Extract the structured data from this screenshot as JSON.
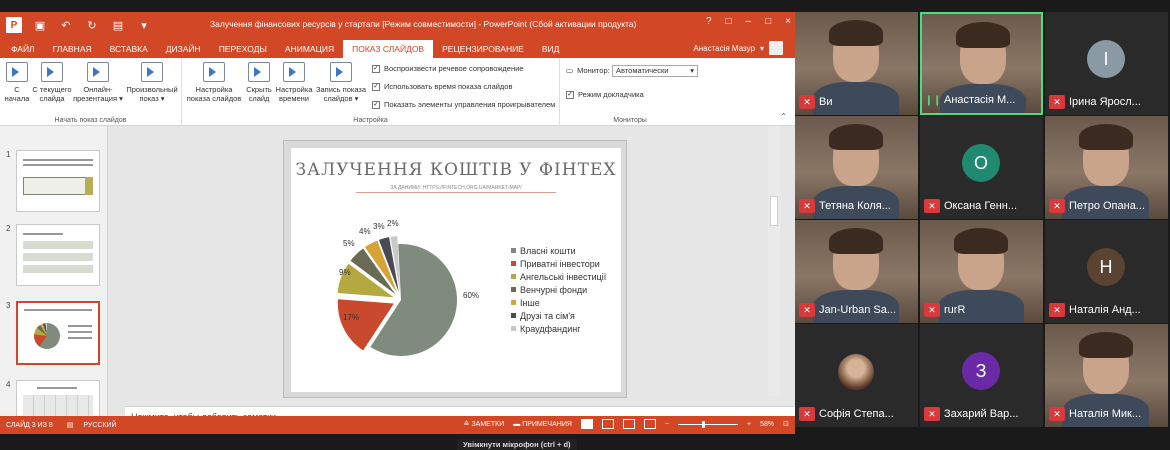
{
  "window": {
    "title": "Залучення фінансових ресурсів у стартапи [Режим совместимости] - PowerPoint (Сбой активации продукта)",
    "app_icon": "P",
    "winctl": [
      "?",
      "□",
      "–",
      "□",
      "×"
    ]
  },
  "tabs": [
    {
      "label": "ФАЙЛ",
      "active": false
    },
    {
      "label": "ГЛАВНАЯ",
      "active": false
    },
    {
      "label": "ВСТАВКА",
      "active": false
    },
    {
      "label": "ДИЗАЙН",
      "active": false
    },
    {
      "label": "ПЕРЕХОДЫ",
      "active": false
    },
    {
      "label": "АНИМАЦИЯ",
      "active": false
    },
    {
      "label": "ПОКАЗ СЛАЙДОВ",
      "active": true
    },
    {
      "label": "РЕЦЕНЗИРОВАНИЕ",
      "active": false
    },
    {
      "label": "ВИД",
      "active": false
    }
  ],
  "user": {
    "name": "Анастасія Мазур"
  },
  "ribbon": {
    "group1": {
      "label": "Начать показ слайдов",
      "buttons": [
        {
          "l1": "С",
          "l2": "начала"
        },
        {
          "l1": "С текущего",
          "l2": "слайда"
        },
        {
          "l1": "Онлайн-",
          "l2": "презентация ▾"
        },
        {
          "l1": "Произвольный",
          "l2": "показ ▾"
        }
      ]
    },
    "group2": {
      "label": "Настройка",
      "buttons": [
        {
          "l1": "Настройка",
          "l2": "показа слайдов"
        },
        {
          "l1": "Скрыть",
          "l2": "слайд"
        },
        {
          "l1": "Настройка",
          "l2": "времени"
        },
        {
          "l1": "Запись показа",
          "l2": "слайдов ▾"
        }
      ],
      "checks": [
        {
          "label": "Воспроизвести речевое сопровождение",
          "checked": true
        },
        {
          "label": "Использовать время показа слайдов",
          "checked": true
        },
        {
          "label": "Показать элементы управления проигрывателем",
          "checked": true
        }
      ]
    },
    "group3": {
      "label": "Мониторы",
      "monitor_label": "Монитор:",
      "monitor_value": "Автоматически",
      "presenter_label": "Режим докладчика"
    }
  },
  "thumbnails": [
    {
      "num": "1",
      "selected": false
    },
    {
      "num": "2",
      "selected": false
    },
    {
      "num": "3",
      "selected": true
    },
    {
      "num": "4",
      "selected": false
    }
  ],
  "slide": {
    "title": "ЗАЛУЧЕННЯ КОШТІВ У ФІНТЕХ",
    "subtitle": "ЗА ДАНИМИ: HTTPS://FINTECH.ORG.UA/MARKET-MAP/",
    "chart_data": {
      "type": "pie",
      "categories": [
        "Власні кошти",
        "Приватні інвестори",
        "Ангельські інвестиції",
        "Венчурні фонди",
        "Інше",
        "Друзі та сім'я",
        "Краудфандинг"
      ],
      "values": [
        60,
        17,
        9,
        5,
        4,
        3,
        2
      ],
      "labels": [
        "60%",
        "17%",
        "9%",
        "5%",
        "4%",
        "3%",
        "2%"
      ],
      "colors": [
        "#7f8b7d",
        "#c8492d",
        "#b3a93e",
        "#6b6a55",
        "#d6a436",
        "#4a4a55",
        "#c9c9c9"
      ],
      "legend_position": "right"
    }
  },
  "notes": {
    "placeholder": "Нажмите, чтобы добавить заметки"
  },
  "status": {
    "slide": "СЛАЙД 3 ИЗ 8",
    "lang": "РУССКИЙ",
    "notes": "ЗАМЕТКИ",
    "comments": "ПРИМЕЧАНИЯ",
    "zoom": "58%"
  },
  "tooltip": "Увімкнути мікрофон (ctrl + d)",
  "participants": [
    {
      "name": "Ви",
      "kind": "video",
      "muted": true
    },
    {
      "name": "Анастасія М...",
      "kind": "video",
      "muted": false,
      "speaking": true
    },
    {
      "name": "Ірина Яросл...",
      "kind": "initial",
      "initial": "І",
      "color": "#8a9aa4",
      "muted": true
    },
    {
      "name": "Тетяна Коля...",
      "kind": "video",
      "muted": true
    },
    {
      "name": "Оксана Генн...",
      "kind": "initial",
      "initial": "О",
      "color": "#1f8a6f",
      "muted": true
    },
    {
      "name": "Петро Опана...",
      "kind": "video",
      "muted": true
    },
    {
      "name": "Jan-Urban Sa...",
      "kind": "video",
      "muted": true
    },
    {
      "name": "rurR",
      "kind": "video",
      "muted": true
    },
    {
      "name": "Наталія Анд...",
      "kind": "initial",
      "initial": "Н",
      "color": "#5a4330",
      "muted": true
    },
    {
      "name": "Софія Степа...",
      "kind": "photo",
      "muted": true
    },
    {
      "name": "Захарий Вар...",
      "kind": "initial",
      "initial": "З",
      "color": "#6a2aa8",
      "muted": true
    },
    {
      "name": "Наталія Мик...",
      "kind": "video",
      "muted": true
    }
  ]
}
